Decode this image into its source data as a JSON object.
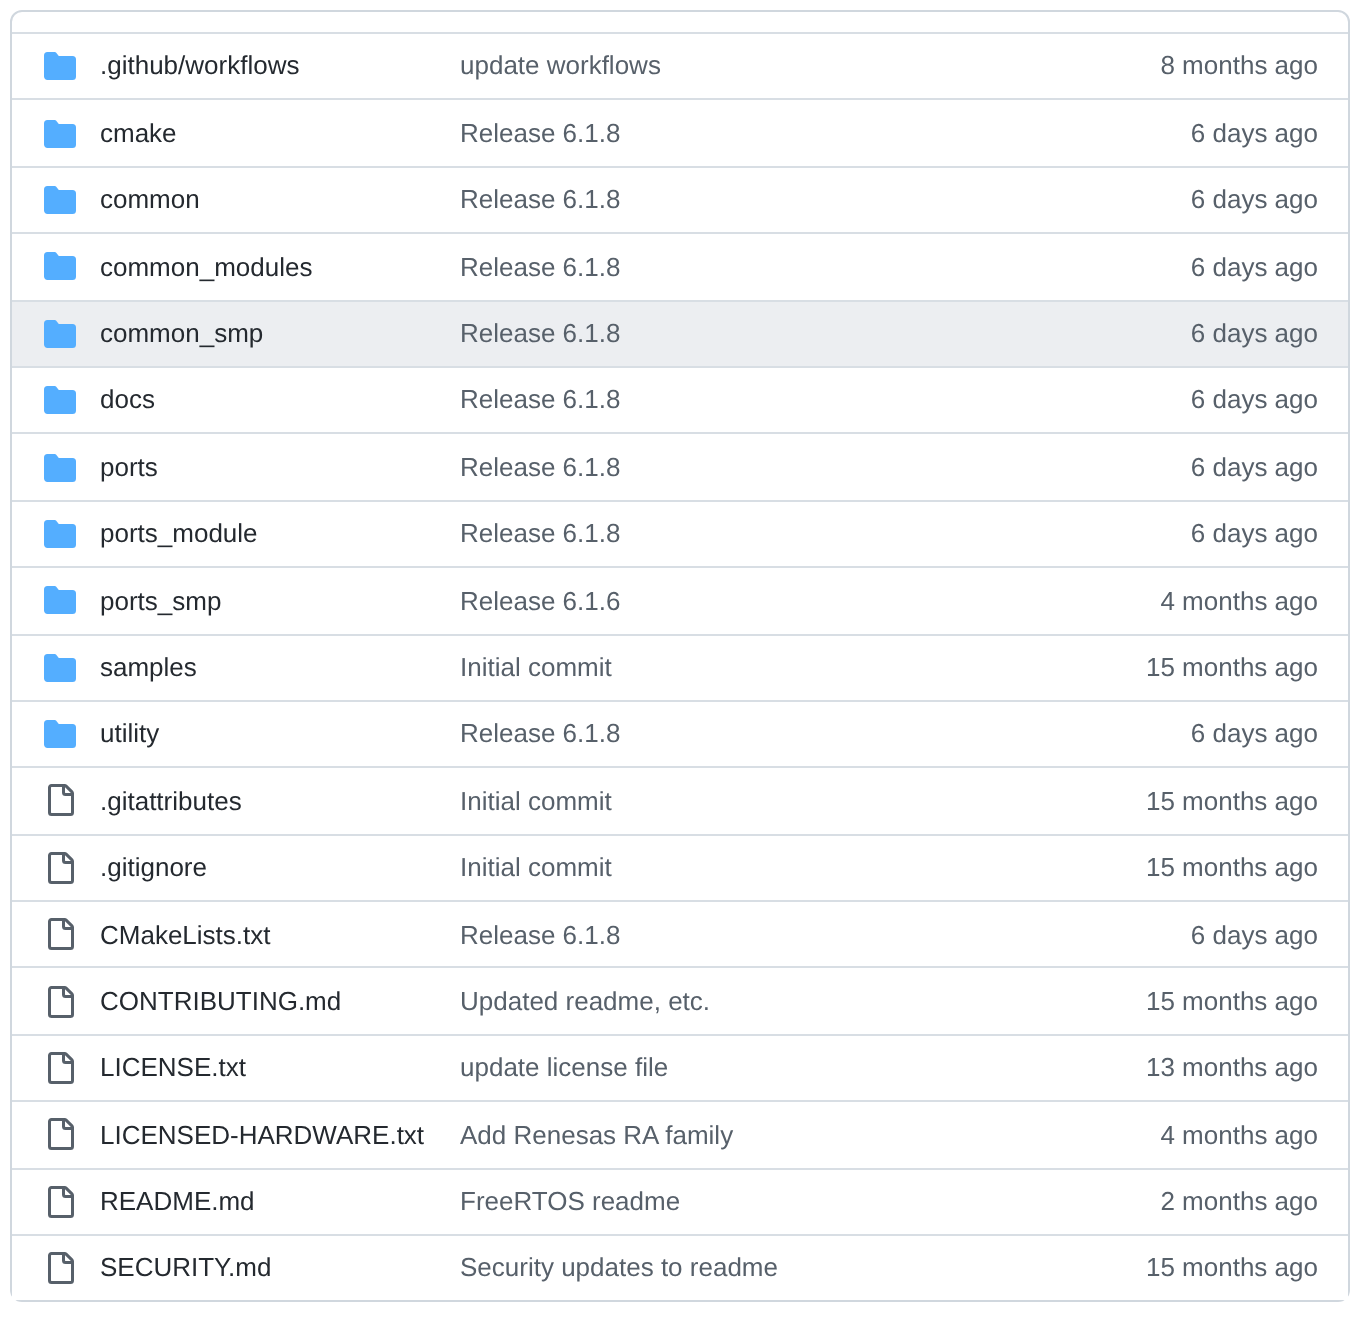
{
  "files": [
    {
      "kind": "folder",
      "name": ".github/workflows",
      "message": "update workflows",
      "time": "8 months ago",
      "hovered": false
    },
    {
      "kind": "folder",
      "name": "cmake",
      "message": "Release 6.1.8",
      "time": "6 days ago",
      "hovered": false
    },
    {
      "kind": "folder",
      "name": "common",
      "message": "Release 6.1.8",
      "time": "6 days ago",
      "hovered": false
    },
    {
      "kind": "folder",
      "name": "common_modules",
      "message": "Release 6.1.8",
      "time": "6 days ago",
      "hovered": false
    },
    {
      "kind": "folder",
      "name": "common_smp",
      "message": "Release 6.1.8",
      "time": "6 days ago",
      "hovered": true
    },
    {
      "kind": "folder",
      "name": "docs",
      "message": "Release 6.1.8",
      "time": "6 days ago",
      "hovered": false
    },
    {
      "kind": "folder",
      "name": "ports",
      "message": "Release 6.1.8",
      "time": "6 days ago",
      "hovered": false
    },
    {
      "kind": "folder",
      "name": "ports_module",
      "message": "Release 6.1.8",
      "time": "6 days ago",
      "hovered": false
    },
    {
      "kind": "folder",
      "name": "ports_smp",
      "message": "Release 6.1.6",
      "time": "4 months ago",
      "hovered": false
    },
    {
      "kind": "folder",
      "name": "samples",
      "message": "Initial commit",
      "time": "15 months ago",
      "hovered": false
    },
    {
      "kind": "folder",
      "name": "utility",
      "message": "Release 6.1.8",
      "time": "6 days ago",
      "hovered": false
    },
    {
      "kind": "file",
      "name": ".gitattributes",
      "message": "Initial commit",
      "time": "15 months ago",
      "hovered": false
    },
    {
      "kind": "file",
      "name": ".gitignore",
      "message": "Initial commit",
      "time": "15 months ago",
      "hovered": false
    },
    {
      "kind": "file",
      "name": "CMakeLists.txt",
      "message": "Release 6.1.8",
      "time": "6 days ago",
      "hovered": false
    },
    {
      "kind": "file",
      "name": "CONTRIBUTING.md",
      "message": "Updated readme, etc.",
      "time": "15 months ago",
      "hovered": false
    },
    {
      "kind": "file",
      "name": "LICENSE.txt",
      "message": "update license file",
      "time": "13 months ago",
      "hovered": false
    },
    {
      "kind": "file",
      "name": "LICENSED-HARDWARE.txt",
      "message": "Add Renesas RA family",
      "time": "4 months ago",
      "hovered": false
    },
    {
      "kind": "file",
      "name": "README.md",
      "message": "FreeRTOS readme",
      "time": "2 months ago",
      "hovered": false
    },
    {
      "kind": "file",
      "name": "SECURITY.md",
      "message": "Security updates to readme",
      "time": "15 months ago",
      "hovered": false
    }
  ]
}
